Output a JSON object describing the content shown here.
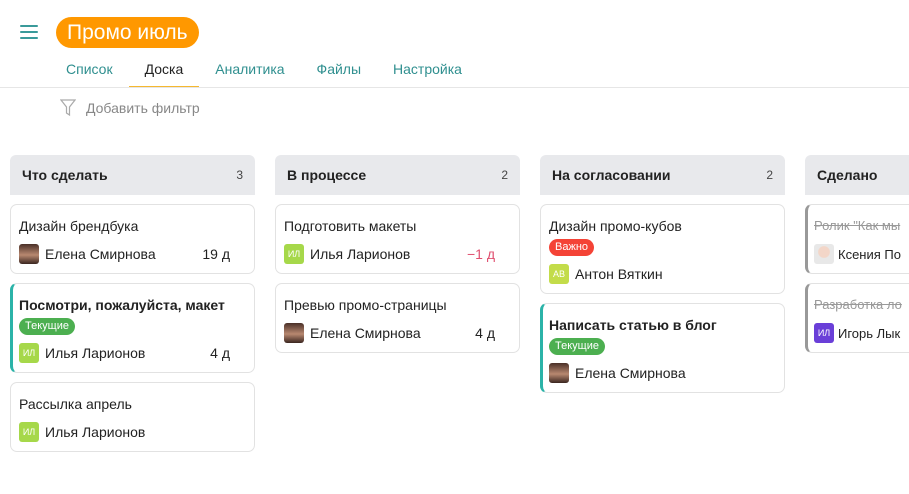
{
  "header": {
    "title": "Промо июль"
  },
  "tabs": [
    {
      "label": "Список"
    },
    {
      "label": "Доска",
      "active": true
    },
    {
      "label": "Аналитика"
    },
    {
      "label": "Файлы"
    },
    {
      "label": "Настройка"
    }
  ],
  "filter": {
    "label": "Добавить фильтр"
  },
  "colors": {
    "accent": "#ff9800",
    "tag_current": "#4caf50",
    "tag_important": "#f44336"
  },
  "columns": [
    {
      "title": "Что сделать",
      "count": "3",
      "cards": [
        {
          "title": "Дизайн брендбука",
          "assignee": "Елена Смирнова",
          "avatar": "photo",
          "days": "19 д"
        },
        {
          "title": "Посмотри, пожалуйста, макет",
          "bold": true,
          "accent": true,
          "tag": "Текущие",
          "tag_color": "#4caf50",
          "assignee": "Илья Ларионов",
          "avatar": "ИЛ",
          "avatar_color": "#a6d84a",
          "days": "4 д"
        },
        {
          "title": "Рассылка апрель",
          "assignee": "Илья Ларионов",
          "avatar": "ИЛ",
          "avatar_color": "#a6d84a"
        }
      ]
    },
    {
      "title": "В процессе",
      "count": "2",
      "cards": [
        {
          "title": "Подготовить макеты",
          "assignee": "Илья Ларионов",
          "avatar": "ИЛ",
          "avatar_color": "#a6d84a",
          "days": "−1 д",
          "overdue": true
        },
        {
          "title": "Превью промо-страницы",
          "assignee": "Елена Смирнова",
          "avatar": "photo",
          "days": "4 д"
        }
      ]
    },
    {
      "title": "На согласовании",
      "count": "2",
      "cards": [
        {
          "title": "Дизайн промо-кубов",
          "tag": "Важно",
          "tag_color": "#f44336",
          "assignee": "Антон Вяткин",
          "avatar": "АВ",
          "avatar_color": "#c3dc4a"
        },
        {
          "title": "Написать статью в блог",
          "bold": true,
          "accent": true,
          "tag": "Текущие",
          "tag_color": "#4caf50",
          "assignee": "Елена Смирнова",
          "avatar": "photo"
        }
      ]
    },
    {
      "title": "Сделано",
      "cards": [
        {
          "title": "Ролик \"Как мы",
          "done": true,
          "assignee": "Ксения По",
          "avatar": "photo2"
        },
        {
          "title": "Разработка ло",
          "done": true,
          "assignee": "Игорь Лык",
          "avatar": "ИЛ",
          "avatar_color": "#6a3fd8"
        }
      ]
    }
  ]
}
